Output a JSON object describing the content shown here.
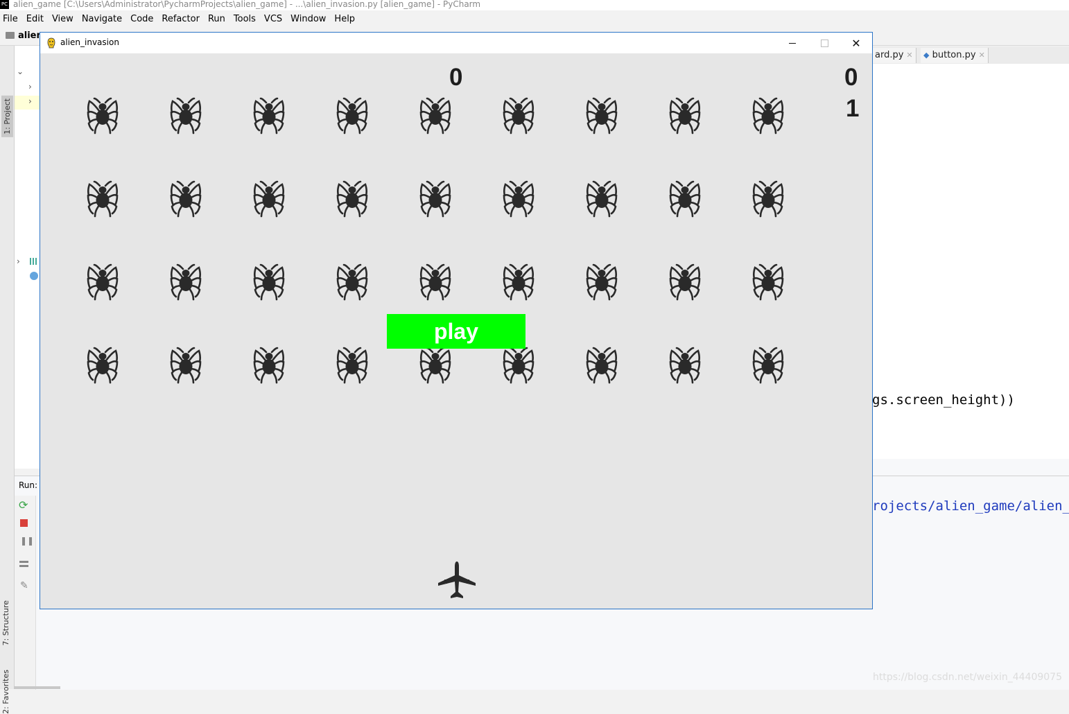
{
  "ide": {
    "title": "alien_game [C:\\Users\\Administrator\\PycharmProjects\\alien_game] - ...\\alien_invasion.py [alien_game] - PyCharm",
    "logo": "PC",
    "menu": [
      "File",
      "Edit",
      "View",
      "Navigate",
      "Code",
      "Refactor",
      "Run",
      "Tools",
      "VCS",
      "Window",
      "Help"
    ],
    "breadcrumb": "alien",
    "project_tab_partial": "P",
    "side_tabs": {
      "project": "1: Project",
      "structure": "7: Structure",
      "favorites": "2: Favorites"
    },
    "run_label": "Run:",
    "editor_tabs": [
      {
        "label": "ard.py"
      },
      {
        "label": "button.py"
      }
    ],
    "code_lines": [
      "gs.screen_height))"
    ],
    "run_output": "rojects/alien_game/alien_i",
    "watermark": "https://blog.csdn.net/weixin_44409075"
  },
  "game": {
    "window_title": "alien_invasion",
    "score": "0",
    "high_score": "0",
    "level": "1",
    "play_label": "play",
    "alien_rows": 4,
    "alien_cols": 9
  },
  "colors": {
    "window_border": "#2b74c7",
    "canvas_bg": "#e6e6e6",
    "play_button": "#00ff00",
    "sprite": "#2a2a2a"
  },
  "icons": {
    "alien": "spider-icon",
    "ship": "airplane-icon",
    "app": "pygame-icon"
  }
}
